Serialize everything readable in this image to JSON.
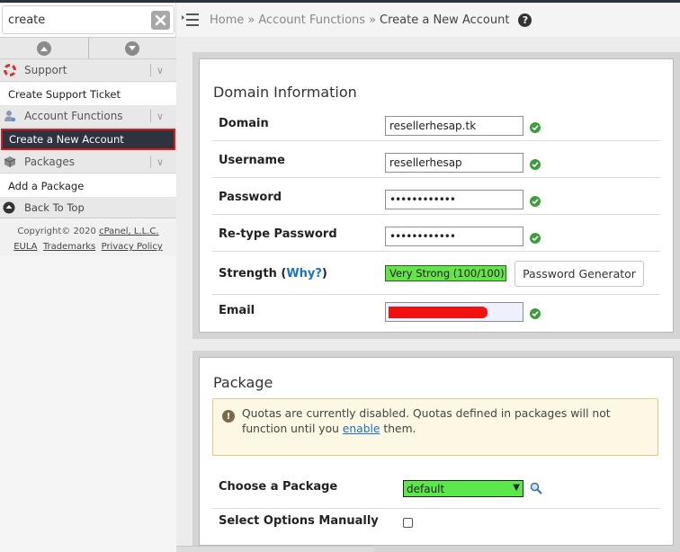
{
  "sidebar": {
    "search_value": "create",
    "groups": {
      "support": {
        "label": "Support",
        "items": [
          "Create Support Ticket"
        ]
      },
      "account_functions": {
        "label": "Account Functions",
        "items": [
          "Create a New Account"
        ]
      },
      "packages": {
        "label": "Packages",
        "items": [
          "Add a Package"
        ]
      }
    },
    "back_to_top": "Back To Top",
    "footer": {
      "copyright": "Copyright© 2020 ",
      "company": "cPanel, L.L.C.",
      "eula": "EULA",
      "trademarks": "Trademarks",
      "privacy": "Privacy Policy"
    }
  },
  "header": {
    "breadcrumb": [
      "Home",
      "»",
      "Account Functions",
      "»",
      "Create a New Account"
    ]
  },
  "domain_info": {
    "title": "Domain Information",
    "domain": {
      "label": "Domain",
      "value": "resellerhesap.tk"
    },
    "username": {
      "label": "Username",
      "value": "resellerhesap"
    },
    "password": {
      "label": "Password",
      "value": "••••••••••••"
    },
    "retype": {
      "label": "Re-type Password",
      "value": "••••••••••••"
    },
    "strength": {
      "label": "Strength (",
      "why": "Why?",
      "close": ")",
      "value": "Very Strong (100/100)",
      "generator_button": "Password Generator"
    },
    "email": {
      "label": "Email"
    }
  },
  "package": {
    "title": "Package",
    "notice": {
      "text_before": "Quotas are currently disabled. Quotas defined in packages will not function until you ",
      "link": "enable",
      "text_after": " them."
    },
    "choose": {
      "label": "Choose a Package",
      "selected": "default"
    },
    "manual": {
      "label": "Select Options Manually"
    }
  },
  "colors": {
    "sidebar_active": "#2d3440",
    "active_outline": "#e8141b",
    "strength_green": "#66e34a",
    "check_green": "#3d9d3d",
    "link_blue": "#1a73c6"
  }
}
